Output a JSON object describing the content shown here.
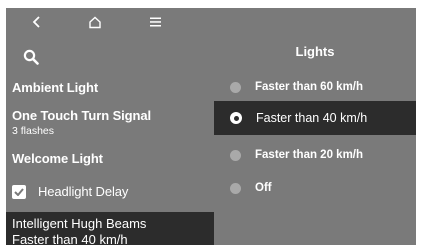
{
  "nav": {
    "back_icon": "chevron-left-icon",
    "home_icon": "home-icon",
    "menu_icon": "menu-icon"
  },
  "search_icon": "search-icon",
  "right": {
    "title": "Lights",
    "options": [
      {
        "label": "Faster than 60 km/h",
        "selected": false
      },
      {
        "label": "Faster than 40 km/h",
        "selected": true
      },
      {
        "label": "Faster than 20 km/h",
        "selected": false
      },
      {
        "label": "Off",
        "selected": false
      }
    ]
  },
  "left": {
    "ambient": {
      "label": "Ambient Light"
    },
    "one_touch": {
      "label": "One Touch Turn Signal",
      "sub": "3 flashes"
    },
    "welcome": {
      "label": "Welcome Light"
    },
    "headlight_delay": {
      "label": "Headlight Delay",
      "checked": true
    },
    "ihb": {
      "label": "Intelligent Hugh Beams",
      "sub": "Faster than 40 km/h"
    }
  },
  "colors": {
    "background": "#7a7a7a",
    "selected_bg": "#2c2c2c",
    "text": "#ffffff",
    "radio_off": "#a9a9a9"
  }
}
